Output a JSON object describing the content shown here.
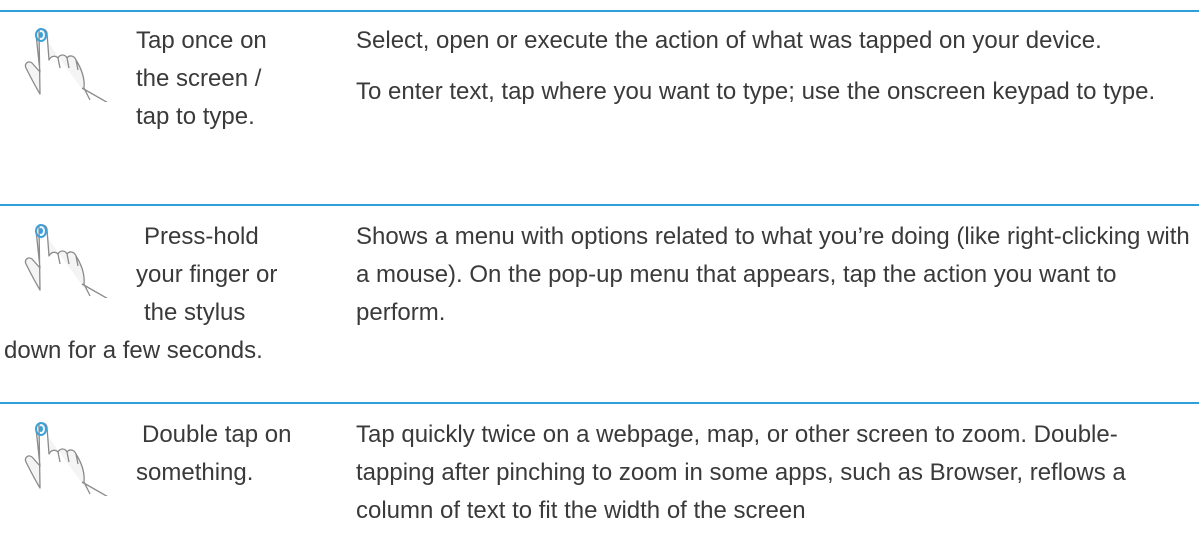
{
  "colors": {
    "rule": "#2f9fd8",
    "text": "#3a3a3a",
    "finger_tip": "#3ba1dc"
  },
  "rows": [
    {
      "icon": "hand-tap-icon",
      "gesture_lines": [
        "Tap once on",
        "the screen /",
        "tap to type."
      ],
      "descriptions": [
        "Select, open or execute the action of what was tapped on your device.",
        "To enter text, tap where you want to type; use the onscreen keypad to type."
      ]
    },
    {
      "icon": "hand-press-hold-icon",
      "gesture_lines": [
        "Press-hold",
        "your finger or",
        "the stylus",
        "down for a few seconds."
      ],
      "descriptions": [
        "Shows a menu with options related to what you’re doing (like right-clicking with a mouse). On the pop-up menu that appears, tap the action you want to perform."
      ]
    },
    {
      "icon": "hand-double-tap-icon",
      "gesture_lines": [
        "Double tap on",
        "something."
      ],
      "descriptions": [
        "Tap quickly twice on a webpage, map, or other screen to zoom. Double-tapping after pinching to zoom in some apps, such as Browser, reflows a column of text to fit the width of the screen"
      ]
    }
  ]
}
